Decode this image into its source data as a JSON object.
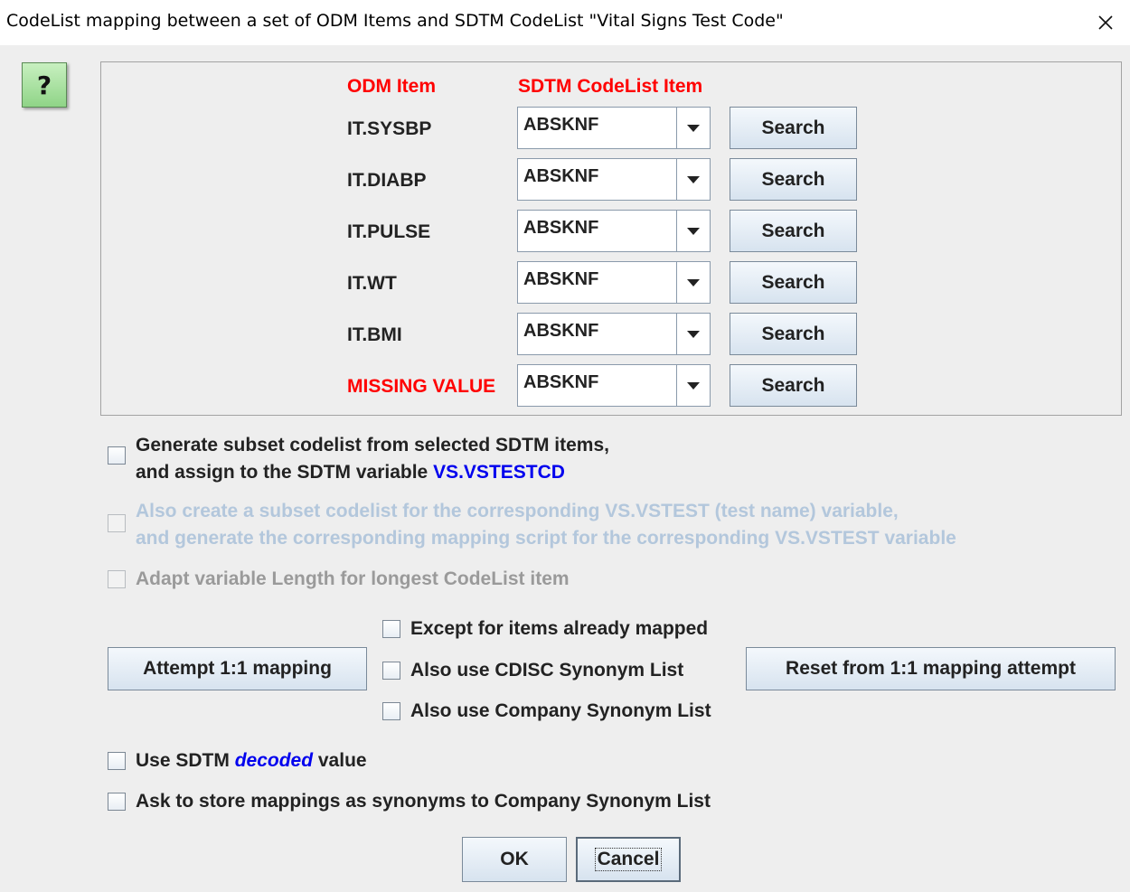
{
  "window": {
    "title": "CodeList mapping between a set of ODM Items and SDTM CodeList \"Vital Signs Test Code\"",
    "close_icon": "close-icon"
  },
  "help": {
    "label": "?"
  },
  "mapping": {
    "header_odm": "ODM Item",
    "header_sdtm": "SDTM CodeList Item",
    "search_label": "Search",
    "rows": [
      {
        "odm": "IT.SYSBP",
        "value": "ABSKNF"
      },
      {
        "odm": "IT.DIABP",
        "value": "ABSKNF"
      },
      {
        "odm": "IT.PULSE",
        "value": "ABSKNF"
      },
      {
        "odm": "IT.WT",
        "value": "ABSKNF"
      },
      {
        "odm": "IT.BMI",
        "value": "ABSKNF"
      },
      {
        "odm": "MISSING VALUE",
        "value": "ABSKNF"
      }
    ]
  },
  "options": {
    "subset_line1": "Generate subset codelist from selected SDTM items,",
    "subset_line2_prefix": "and assign to the SDTM variable ",
    "subset_var": "VS.VSTESTCD",
    "also_line1": "Also create a subset codelist for the corresponding VS.VSTEST (test name) variable,",
    "also_line2": "and generate the corresponding mapping script for the corresponding VS.VSTEST variable",
    "adapt_length": "Adapt variable Length for longest CodeList item",
    "except_mapped": "Except for items already mapped",
    "cdisc_synonym": "Also use CDISC Synonym List",
    "company_synonym": "Also use Company Synonym List",
    "use_decoded_prefix": "Use SDTM ",
    "use_decoded_em": "decoded",
    "use_decoded_suffix": " value",
    "ask_store": "Ask to store mappings as synonyms to Company Synonym List"
  },
  "buttons": {
    "attempt": "Attempt 1:1 mapping",
    "reset": "Reset from 1:1 mapping attempt",
    "ok": "OK",
    "cancel": "Cancel"
  }
}
